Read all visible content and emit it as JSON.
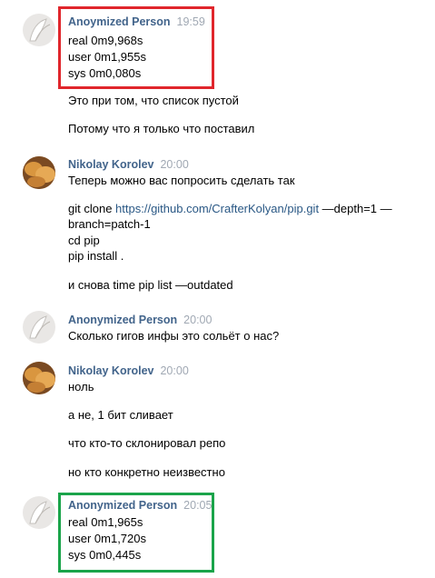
{
  "colors": {
    "author": "#42648b",
    "time": "#a0a8b3",
    "link": "#2a5885",
    "red_highlight": "#e0262c",
    "green_highlight": "#1aa44a"
  },
  "messages": [
    {
      "author": "Anoymized Person",
      "time": "19:59",
      "avatar": "anonymized-avatar",
      "lines": [
        "real 0m9,968s",
        "user 0m1,955s",
        "sys 0m0,080s",
        "Это при том, что список пустой",
        "Потому что я только что поставил"
      ]
    },
    {
      "author": "Nikolay Korolev",
      "time": "20:00",
      "avatar": "bread-avatar",
      "lines": [
        "Теперь можно вас попросить сделать так",
        "git clone ",
        "https://github.com/CrafterKolyan/pip.git",
        " —depth=1 —",
        "branch=patch-1",
        "cd pip",
        "pip install .",
        "и снова time pip list —outdated"
      ]
    },
    {
      "author": "Anonymized Person",
      "time": "20:00",
      "avatar": "anonymized-avatar",
      "lines": [
        "Сколько гигов инфы это сольёт о нас?"
      ]
    },
    {
      "author": "Nikolay Korolev",
      "time": "20:00",
      "avatar": "bread-avatar",
      "lines": [
        "ноль",
        "а не, 1 бит сливает",
        "что кто-то склонировал репо",
        "но кто конкретно неизвестно"
      ]
    },
    {
      "author": "Anonymized Person",
      "time": "20:05",
      "avatar": "anonymized-avatar",
      "lines": [
        "real 0m1,965s",
        "user 0m1,720s",
        "sys 0m0,445s"
      ]
    }
  ]
}
